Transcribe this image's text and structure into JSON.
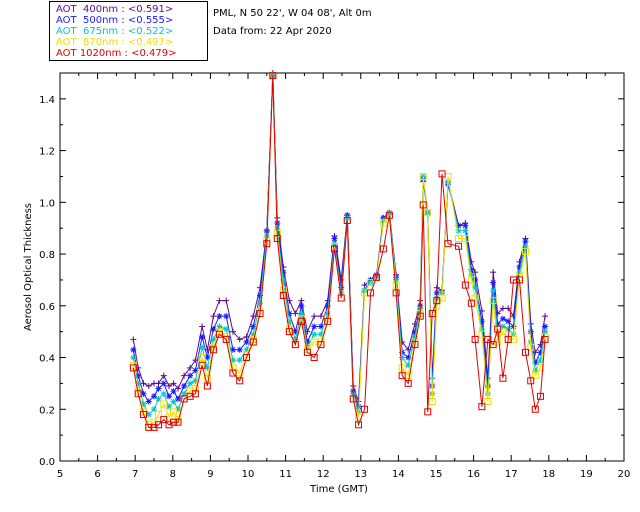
{
  "legend": [
    {
      "name": "AOT  400nm : <0.591>",
      "color": "#5a0a8a"
    },
    {
      "name": "AOT  500nm : <0.555>",
      "color": "#1a1aff"
    },
    {
      "name": "AOT  675nm : <0.522>",
      "color": "#00c8c8"
    },
    {
      "name": "AOT  870nm : <0.497>",
      "color": "#f0e000"
    },
    {
      "name": "AOT 1020nm : <0.479>",
      "color": "#e00000"
    }
  ],
  "info": {
    "site": "PML, N 50 22', W 04 08', Alt 0m",
    "date": "Data from: 22 Apr 2020"
  },
  "chart_data": {
    "type": "line",
    "xlabel": "Time (GMT)",
    "ylabel": "Aerosol Optical Thickness",
    "xlim": [
      5,
      20
    ],
    "ylim": [
      0,
      1.5
    ],
    "xticks": [
      5,
      6,
      7,
      8,
      9,
      10,
      11,
      12,
      13,
      14,
      15,
      16,
      17,
      18,
      19,
      20
    ],
    "yticks": [
      "0.0",
      "0.2",
      "0.4",
      "0.6",
      "0.8",
      "1.0",
      "1.2",
      "1.4"
    ],
    "x": [
      6.95,
      7.08,
      7.22,
      7.36,
      7.5,
      7.62,
      7.76,
      7.9,
      8.02,
      8.14,
      8.3,
      8.46,
      8.6,
      8.78,
      8.92,
      9.08,
      9.24,
      9.42,
      9.6,
      9.78,
      9.96,
      10.14,
      10.32,
      10.5,
      10.66,
      10.78,
      10.94,
      11.1,
      11.26,
      11.42,
      11.58,
      11.76,
      11.94,
      12.12,
      12.3,
      12.48,
      12.64,
      12.8,
      12.94,
      13.1,
      13.26,
      13.42,
      13.6,
      13.76,
      13.94,
      14.1,
      14.26,
      14.44,
      14.58,
      14.66,
      14.78,
      14.9,
      15.02,
      15.16,
      15.32,
      15.6,
      15.78,
      15.94,
      16.04,
      16.22,
      16.38,
      16.52,
      16.64,
      16.78,
      16.92,
      17.06,
      17.22,
      17.38,
      17.52,
      17.64,
      17.78,
      17.9
    ],
    "series": [
      {
        "name": "AOT  400nm : <0.591>",
        "values": [
          0.47,
          0.36,
          0.3,
          0.29,
          0.3,
          0.3,
          0.33,
          0.29,
          0.3,
          0.28,
          0.33,
          0.36,
          0.39,
          0.52,
          0.43,
          0.56,
          0.62,
          0.62,
          0.5,
          0.47,
          0.48,
          0.56,
          0.67,
          0.89,
          1.5,
          0.94,
          0.75,
          0.62,
          0.57,
          0.62,
          0.5,
          0.56,
          0.56,
          0.62,
          0.87,
          0.7,
          0.95,
          0.29,
          0.23,
          0.68,
          0.7,
          0.72,
          0.94,
          0.96,
          0.72,
          0.46,
          0.43,
          0.53,
          0.62,
          1.08,
          0.96,
          0.32,
          0.67,
          0.66,
          1.08,
          0.91,
          0.92,
          0.77,
          0.73,
          0.58,
          0.32,
          0.73,
          0.57,
          0.59,
          0.59,
          0.56,
          0.77,
          0.86,
          0.53,
          0.42,
          0.45,
          0.56
        ]
      },
      {
        "name": "AOT  500nm : <0.555>",
        "values": [
          0.43,
          0.33,
          0.26,
          0.23,
          0.25,
          0.28,
          0.3,
          0.25,
          0.27,
          0.24,
          0.29,
          0.33,
          0.35,
          0.48,
          0.4,
          0.51,
          0.56,
          0.56,
          0.43,
          0.43,
          0.46,
          0.52,
          0.64,
          0.89,
          1.49,
          0.92,
          0.73,
          0.57,
          0.5,
          0.6,
          0.46,
          0.52,
          0.52,
          0.6,
          0.86,
          0.67,
          0.95,
          0.27,
          0.21,
          0.66,
          0.7,
          0.72,
          0.94,
          0.96,
          0.71,
          0.42,
          0.4,
          0.5,
          0.6,
          1.09,
          0.96,
          0.29,
          0.65,
          0.65,
          1.07,
          0.91,
          0.91,
          0.74,
          0.7,
          0.54,
          0.29,
          0.69,
          0.53,
          0.55,
          0.54,
          0.52,
          0.75,
          0.85,
          0.5,
          0.38,
          0.42,
          0.52
        ]
      },
      {
        "name": "AOT  675nm : <0.522>",
        "values": [
          0.4,
          0.3,
          0.22,
          0.18,
          0.2,
          0.24,
          0.26,
          0.21,
          0.23,
          0.2,
          0.26,
          0.3,
          0.31,
          0.44,
          0.36,
          0.47,
          0.52,
          0.51,
          0.39,
          0.39,
          0.43,
          0.49,
          0.61,
          0.87,
          1.49,
          0.9,
          0.7,
          0.54,
          0.47,
          0.57,
          0.44,
          0.49,
          0.49,
          0.57,
          0.84,
          0.65,
          0.94,
          0.26,
          0.19,
          0.66,
          0.69,
          0.71,
          0.93,
          0.96,
          0.7,
          0.4,
          0.37,
          0.48,
          0.59,
          1.1,
          0.96,
          0.26,
          0.63,
          0.65,
          1.08,
          0.89,
          0.89,
          0.72,
          0.67,
          0.51,
          0.26,
          0.66,
          0.49,
          0.52,
          0.51,
          0.49,
          0.73,
          0.83,
          0.46,
          0.35,
          0.39,
          0.5
        ]
      },
      {
        "name": "AOT  870nm : <0.497>",
        "values": [
          0.37,
          0.27,
          0.19,
          0.14,
          0.15,
          0.18,
          0.22,
          0.17,
          0.19,
          0.16,
          0.24,
          0.27,
          0.28,
          0.4,
          0.32,
          0.44,
          0.5,
          0.48,
          0.36,
          0.34,
          0.41,
          0.47,
          0.58,
          0.85,
          1.49,
          0.88,
          0.66,
          0.51,
          0.45,
          0.55,
          0.43,
          0.46,
          0.46,
          0.55,
          0.83,
          0.63,
          0.93,
          0.24,
          0.17,
          0.65,
          0.69,
          0.71,
          0.92,
          0.95,
          0.68,
          0.36,
          0.33,
          0.46,
          0.57,
          1.1,
          0.96,
          0.23,
          0.6,
          0.63,
          1.1,
          0.86,
          0.86,
          0.7,
          0.63,
          0.49,
          0.23,
          0.62,
          0.46,
          0.5,
          0.47,
          0.47,
          0.71,
          0.81,
          0.44,
          0.33,
          0.36,
          0.48
        ]
      },
      {
        "name": "AOT 1020nm : <0.479>",
        "values": [
          0.36,
          0.26,
          0.18,
          0.13,
          0.13,
          0.14,
          0.16,
          0.14,
          0.15,
          0.15,
          0.24,
          0.25,
          0.26,
          0.37,
          0.29,
          0.43,
          0.49,
          0.47,
          0.34,
          0.31,
          0.4,
          0.46,
          0.57,
          0.84,
          1.49,
          0.86,
          0.64,
          0.5,
          0.45,
          0.54,
          0.42,
          0.4,
          0.45,
          0.54,
          0.82,
          0.63,
          0.93,
          0.24,
          0.14,
          0.2,
          0.65,
          0.71,
          0.82,
          0.95,
          0.65,
          0.33,
          0.3,
          0.45,
          0.56,
          0.99,
          0.19,
          0.57,
          0.62,
          1.11,
          0.84,
          0.83,
          0.68,
          0.61,
          0.47,
          0.21,
          0.47,
          0.45,
          0.51,
          0.32,
          0.47,
          0.7,
          0.7,
          0.42,
          0.31,
          0.2,
          0.25,
          0.47
        ]
      }
    ]
  }
}
